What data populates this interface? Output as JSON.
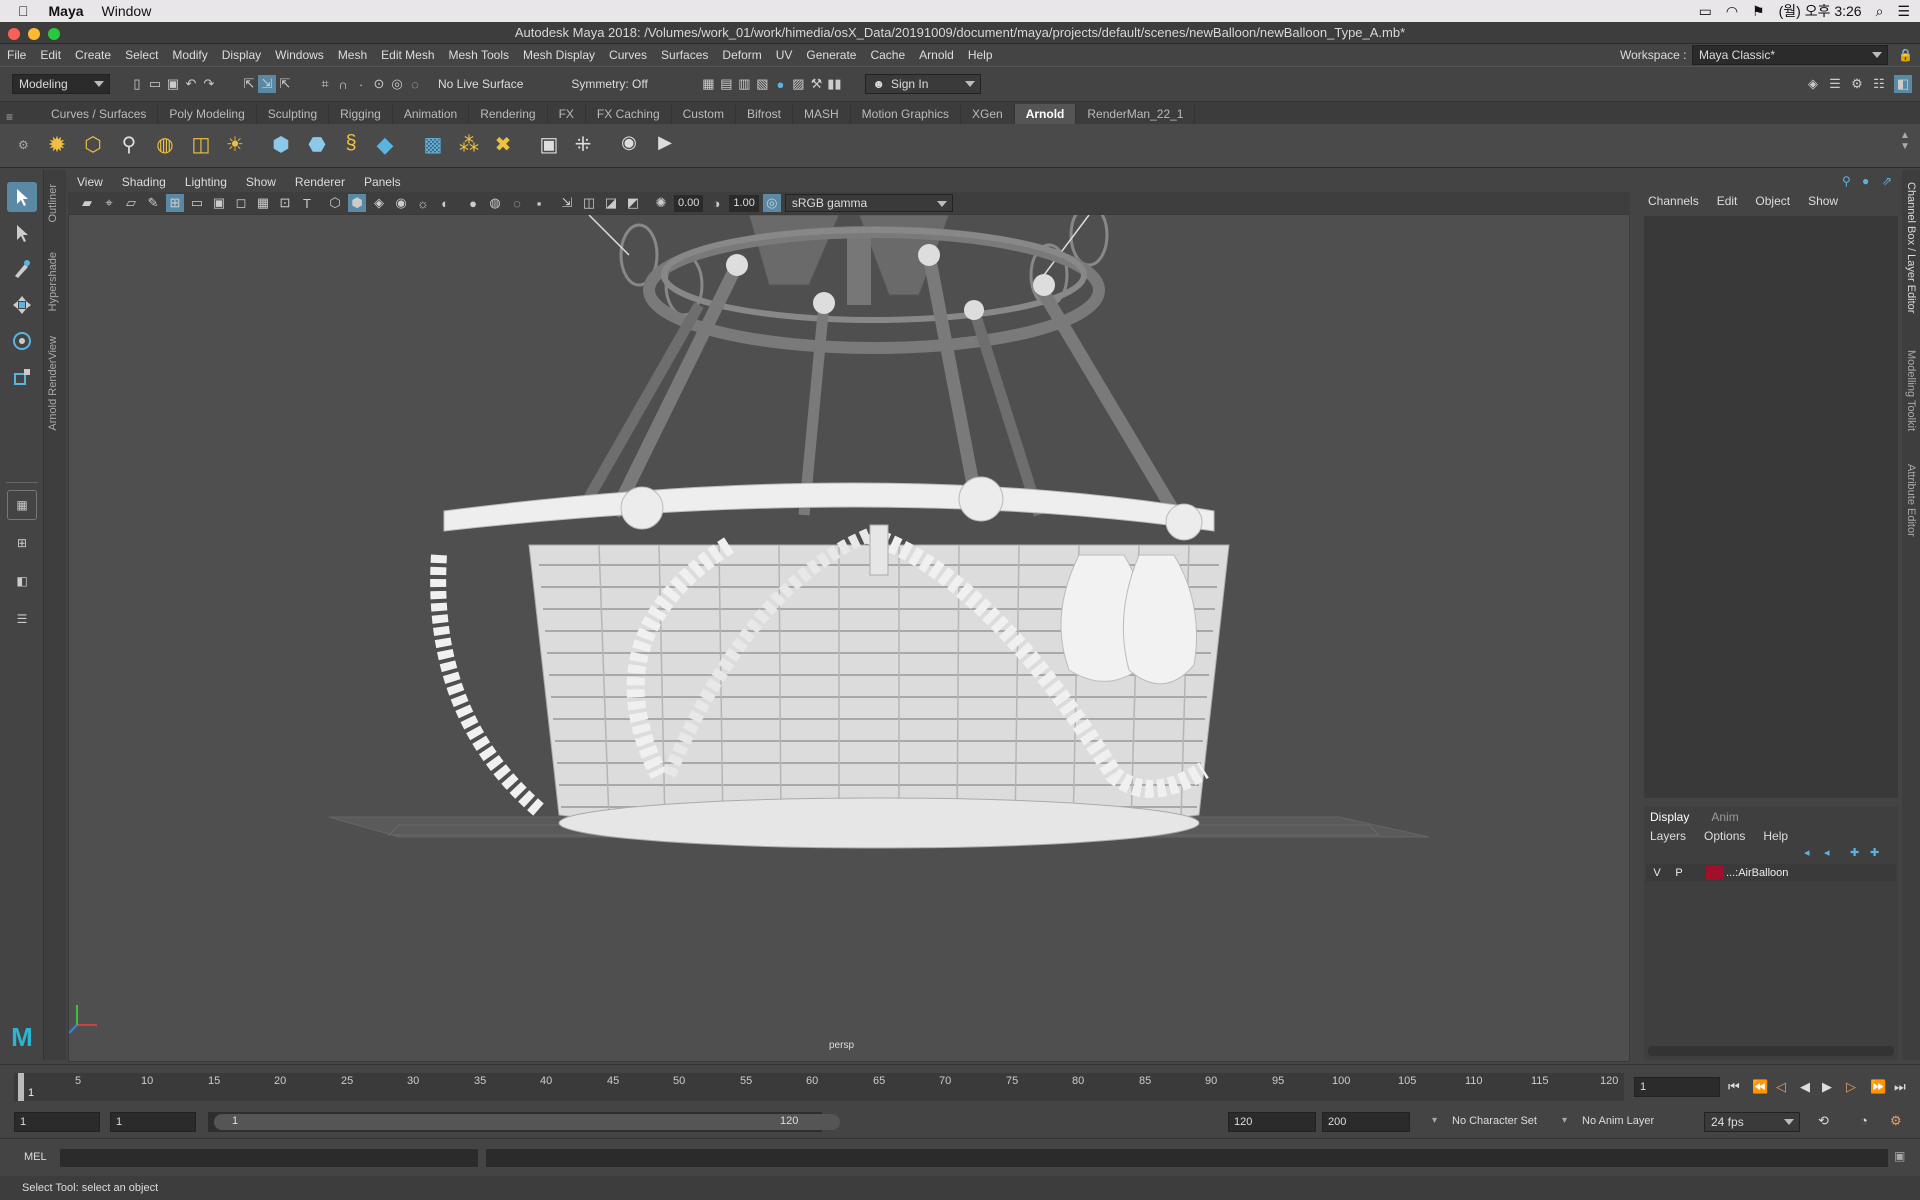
{
  "mac_menu": {
    "app": "Maya",
    "window": "Window",
    "clock": "(월) 오후 3:26"
  },
  "title": "Autodesk Maya 2018: /Volumes/work_01/work/himedia/osX_Data/20191009/document/maya/projects/default/scenes/newBalloon/newBalloon_Type_A.mb*",
  "menus": [
    "File",
    "Edit",
    "Create",
    "Select",
    "Modify",
    "Display",
    "Windows",
    "Mesh",
    "Edit Mesh",
    "Mesh Tools",
    "Mesh Display",
    "Curves",
    "Surfaces",
    "Deform",
    "UV",
    "Generate",
    "Cache",
    "Arnold",
    "Help"
  ],
  "workspace": {
    "label": "Workspace :",
    "value": "Maya Classic*"
  },
  "status": {
    "mode": "Modeling",
    "live_surface": "No Live Surface",
    "symmetry": "Symmetry: Off",
    "sign_in": "Sign In"
  },
  "shelf_tabs": [
    "Curves / Surfaces",
    "Poly Modeling",
    "Sculpting",
    "Rigging",
    "Animation",
    "Rendering",
    "FX",
    "FX Caching",
    "Custom",
    "Bifrost",
    "MASH",
    "Motion Graphics",
    "XGen",
    "Arnold",
    "RenderMan_22_1"
  ],
  "active_shelf": "Arnold",
  "side_tabs": [
    "Outliner",
    "Hypershade",
    "Arnold RenderView"
  ],
  "right_tabs": [
    "Channel Box / Layer Editor",
    "Modelling Toolkit",
    "Attribute Editor"
  ],
  "viewport": {
    "menus": [
      "View",
      "Shading",
      "Lighting",
      "Show",
      "Renderer",
      "Panels"
    ],
    "exposure": "0.00",
    "gamma": "1.00",
    "colorspace": "sRGB gamma",
    "camera": "persp"
  },
  "channel_box": {
    "menus": [
      "Channels",
      "Edit",
      "Object",
      "Show"
    ]
  },
  "layer_editor": {
    "tabs": [
      "Display",
      "Anim"
    ],
    "menus": [
      "Layers",
      "Options",
      "Help"
    ],
    "layer": {
      "v": "V",
      "p": "P",
      "name": "...:AirBalloon",
      "color": "#a0102a"
    }
  },
  "timeline": {
    "ticks": [
      "1",
      "5",
      "10",
      "15",
      "20",
      "25",
      "30",
      "35",
      "40",
      "45",
      "50",
      "55",
      "60",
      "65",
      "70",
      "75",
      "80",
      "85",
      "90",
      "95",
      "100",
      "105",
      "110",
      "115",
      "120"
    ],
    "current_frame": "1"
  },
  "range": {
    "start": "1",
    "playback_start": "1",
    "range_start_label": "1",
    "range_end_label": "120",
    "playback_end": "120",
    "end": "200",
    "character_set": "No Character Set",
    "anim_layer": "No Anim Layer",
    "fps": "24 fps"
  },
  "command": {
    "lang": "MEL"
  },
  "help_line": "Select Tool: select an object"
}
